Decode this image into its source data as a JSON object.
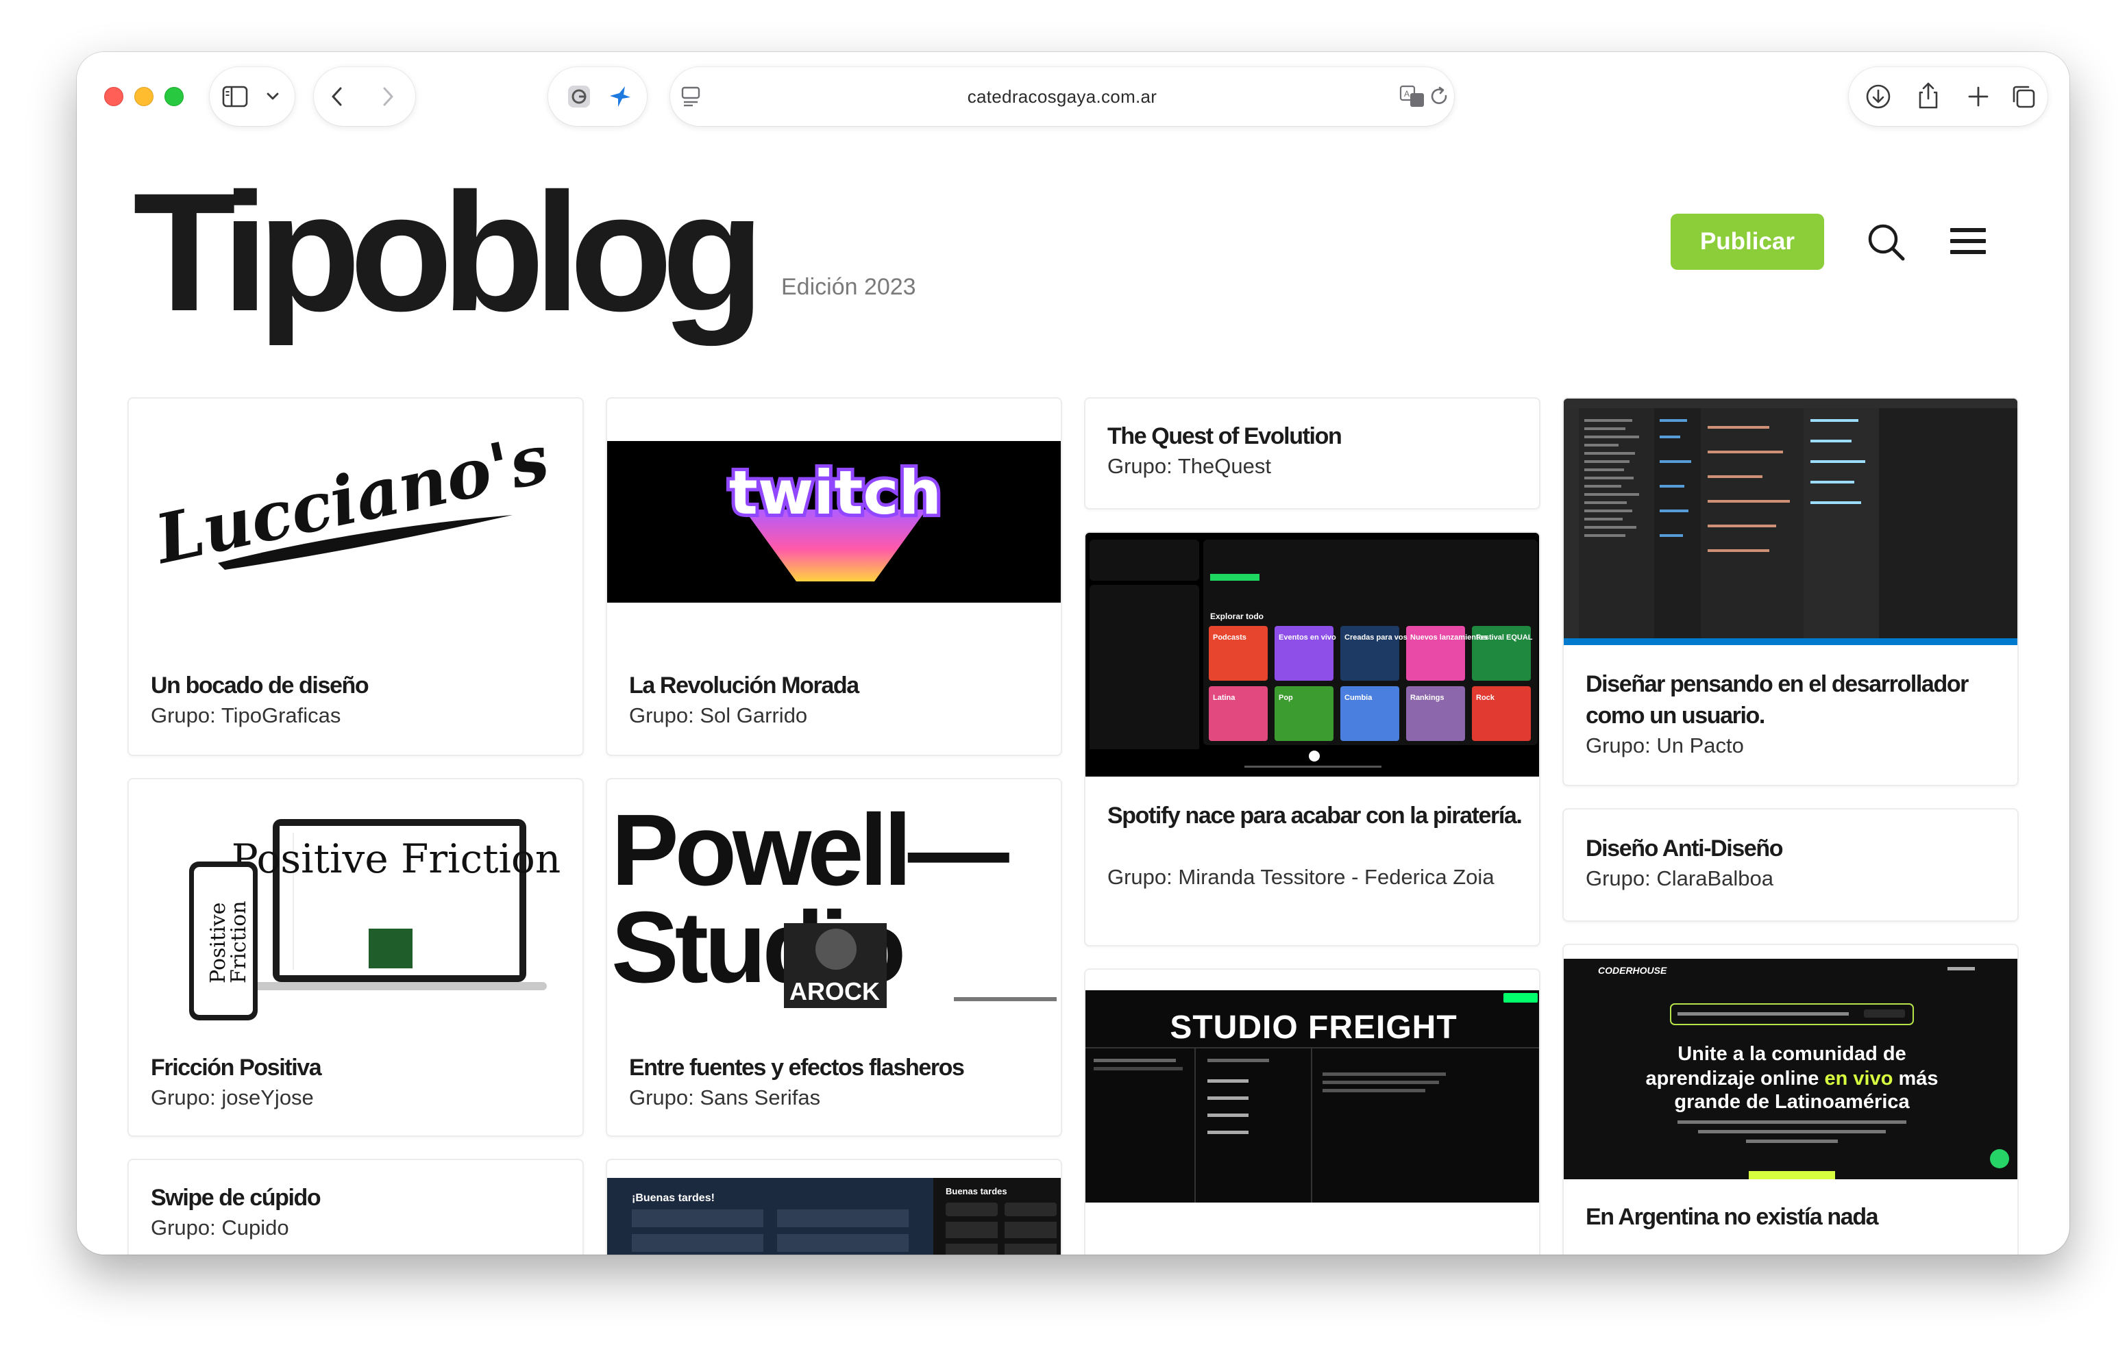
{
  "browser": {
    "url": "catedracosgaya.com.ar"
  },
  "header": {
    "title": "Tipoblog",
    "edition": "Edición 2023",
    "publish_label": "Publicar"
  },
  "colors": {
    "accent": "#8ccd3a",
    "text": "#1b1b1b",
    "muted": "#7a7a7a",
    "twitch_purple": "#9146ff",
    "spotify_green": "#1ed760"
  },
  "cards": [
    {
      "title": "Un bocado de diseño",
      "group": "Grupo: TipoGraficas",
      "image_text": "Lucciano's"
    },
    {
      "title": "La Revolución Morada",
      "group": "Grupo: Sol Garrido",
      "image_text": "twitch"
    },
    {
      "title": "The Quest of Evolution",
      "group": "Grupo: TheQuest"
    },
    {
      "title": "Diseñar pensando en el desarrollador como un usuario.",
      "group": "Grupo: Un Pacto"
    },
    {
      "title": "Spotify nace para acabar con la piratería.",
      "group": "Grupo: Miranda Tessitore - Federica Zoia"
    },
    {
      "title": "Fricción Positiva",
      "group": "Grupo: joseYjose",
      "image_text": "Positive Friction"
    },
    {
      "title": "Entre fuentes y efectos flasheros",
      "group": "Grupo: Sans Serifas",
      "image_text_1": "Powell—",
      "image_text_2": "Studio",
      "image_text_3": "AROCK"
    },
    {
      "title": "Diseño Anti-Diseño",
      "group": "Grupo: ClaraBalboa"
    },
    {
      "title": "Swipe de cúpido",
      "group": "Grupo: Cupido"
    },
    {
      "title": "En Argentina no existía nada",
      "group": ""
    },
    {
      "title": "",
      "group": "",
      "image_text": "STUDIO FREIGHT"
    },
    {
      "title": "",
      "group": "",
      "image_text_1": "Unite a la comunidad de",
      "image_text_2": "aprendizaje online",
      "image_text_3": "en vivo",
      "image_text_4": "más",
      "image_text_5": "grande de Latinoamérica",
      "image_logo": "CODERHOUSE"
    }
  ],
  "thumbs": {
    "spotify": {
      "section": "Explorar todo",
      "tiles": [
        "Podcasts",
        "Eventos en vivo",
        "Creadas para vos",
        "Nuevos lanzamientos",
        "Festival EQUAL",
        "Latina",
        "Pop",
        "Cumbia",
        "Rankings",
        "Rock"
      ]
    },
    "spotify2": {
      "greeting": "¡Buenas tardes!",
      "greeting_2": "Buenas tardes"
    }
  }
}
